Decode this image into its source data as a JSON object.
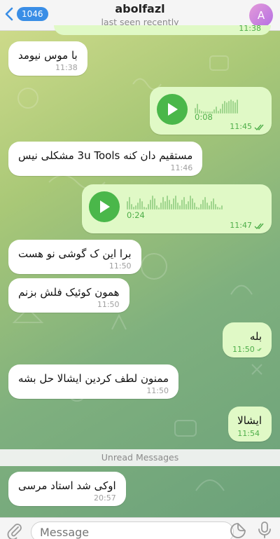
{
  "header": {
    "back_count": "1046",
    "title": "abolfazl",
    "subtitle": "last seen recently",
    "avatar_letter": "A"
  },
  "top_fragment": {
    "time": "11:38"
  },
  "messages": [
    {
      "type": "text",
      "direction": "in",
      "text": "با موس نیومد",
      "time": "11:38"
    },
    {
      "type": "voice",
      "direction": "out",
      "duration": "0:08",
      "time": "11:45",
      "read": true
    },
    {
      "type": "text",
      "direction": "in",
      "text": "مستقیم دان کنه 3u Tools مشکلی نیس",
      "time": "11:46"
    },
    {
      "type": "voice",
      "direction": "out",
      "duration": "0:24",
      "time": "11:47",
      "read": true
    },
    {
      "type": "text",
      "direction": "in",
      "text": "برا این ک گوشی نو هست",
      "time": "11:50"
    },
    {
      "type": "text",
      "direction": "in",
      "text": "همون کوئیک فلش بزنم",
      "time": "11:50"
    },
    {
      "type": "text",
      "direction": "out",
      "text": "بله",
      "time": "11:50",
      "read": true
    },
    {
      "type": "text",
      "direction": "in",
      "text": "ممنون لطف کردین ایشالا حل بشه",
      "time": "11:50"
    },
    {
      "type": "text",
      "direction": "out",
      "text": "ایشالا",
      "time": "11:54",
      "read": true
    },
    {
      "type": "text",
      "direction": "in",
      "text": "اوکی شد استاد  مرسی",
      "time": "20:57"
    }
  ],
  "unread_divider": "Unread Messages",
  "input": {
    "placeholder": "Message"
  },
  "icons": {
    "back": "chevron-left-icon",
    "attach": "paperclip-icon",
    "sticker": "sticker-icon",
    "mic": "microphone-icon",
    "play": "play-icon",
    "read": "double-check-icon"
  },
  "colors": {
    "accent": "#3a8ee6",
    "outgoing_bubble": "#e0f9c6",
    "incoming_bubble": "#ffffff",
    "play_button": "#4ab74a",
    "read_ticks": "#4eae49"
  }
}
